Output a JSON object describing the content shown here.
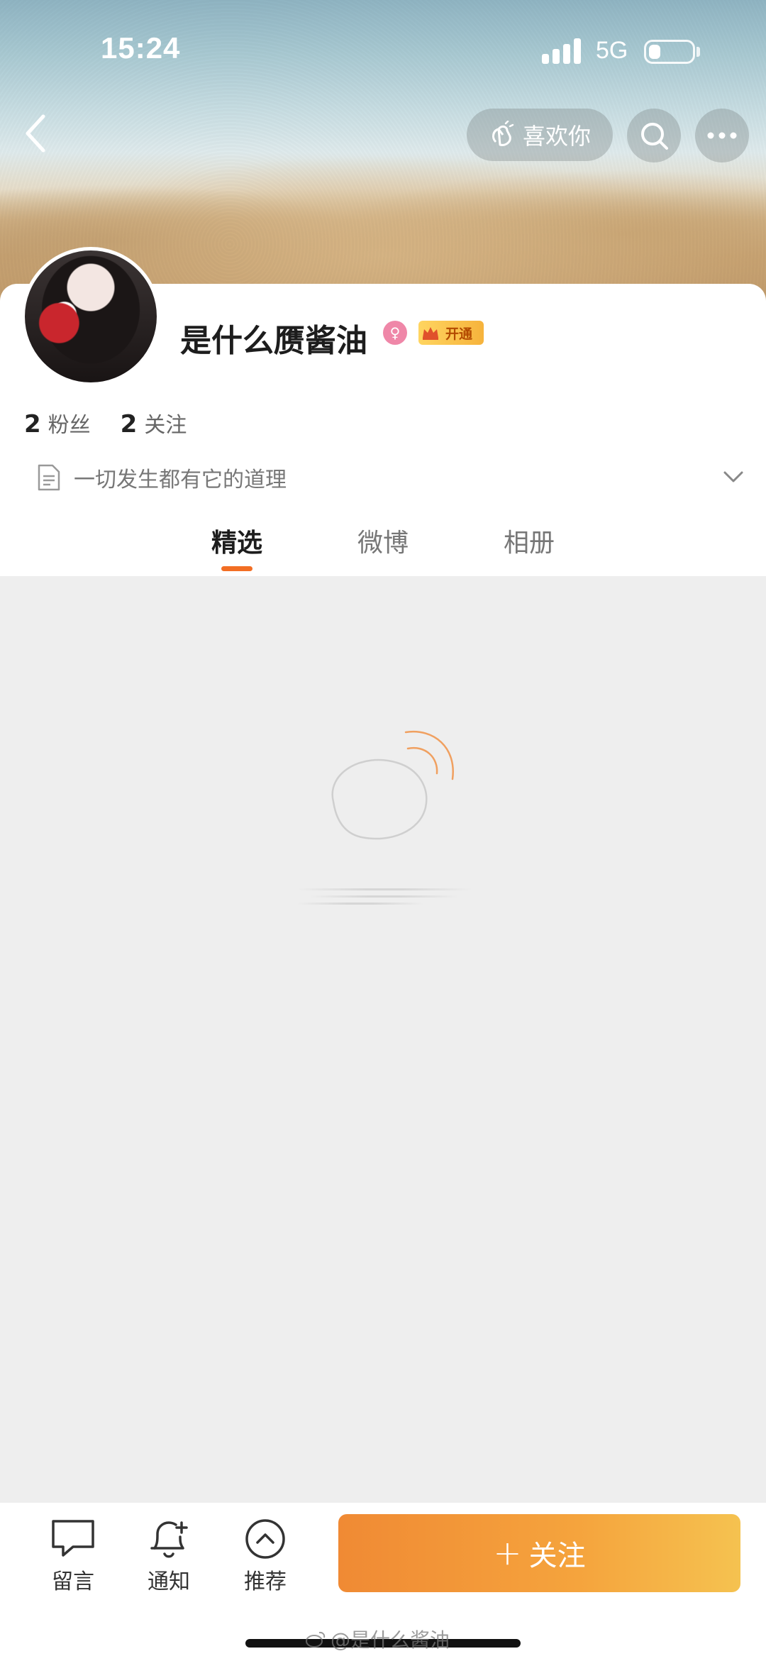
{
  "status_bar": {
    "time": "15:24",
    "network": "5G",
    "battery_level": 0.25
  },
  "header": {
    "like_label": "喜欢你"
  },
  "profile": {
    "nickname": "是什么赝酱油",
    "vip_label": "开通",
    "fans_count": "2",
    "fans_label": "粉丝",
    "following_count": "2",
    "following_label": "关注",
    "bio": "一切发生都有它的道理"
  },
  "tabs": [
    {
      "label": "精选",
      "active": true
    },
    {
      "label": "微博",
      "active": false
    },
    {
      "label": "相册",
      "active": false
    }
  ],
  "bottom_bar": {
    "message_label": "留言",
    "notify_label": "通知",
    "recommend_label": "推荐",
    "follow_label": "关注"
  },
  "watermark": "@是什么酱油",
  "colors": {
    "accent": "#f26e24",
    "follow_start": "#f08a34",
    "follow_end": "#f5c250",
    "content_bg": "#eeeeee"
  }
}
